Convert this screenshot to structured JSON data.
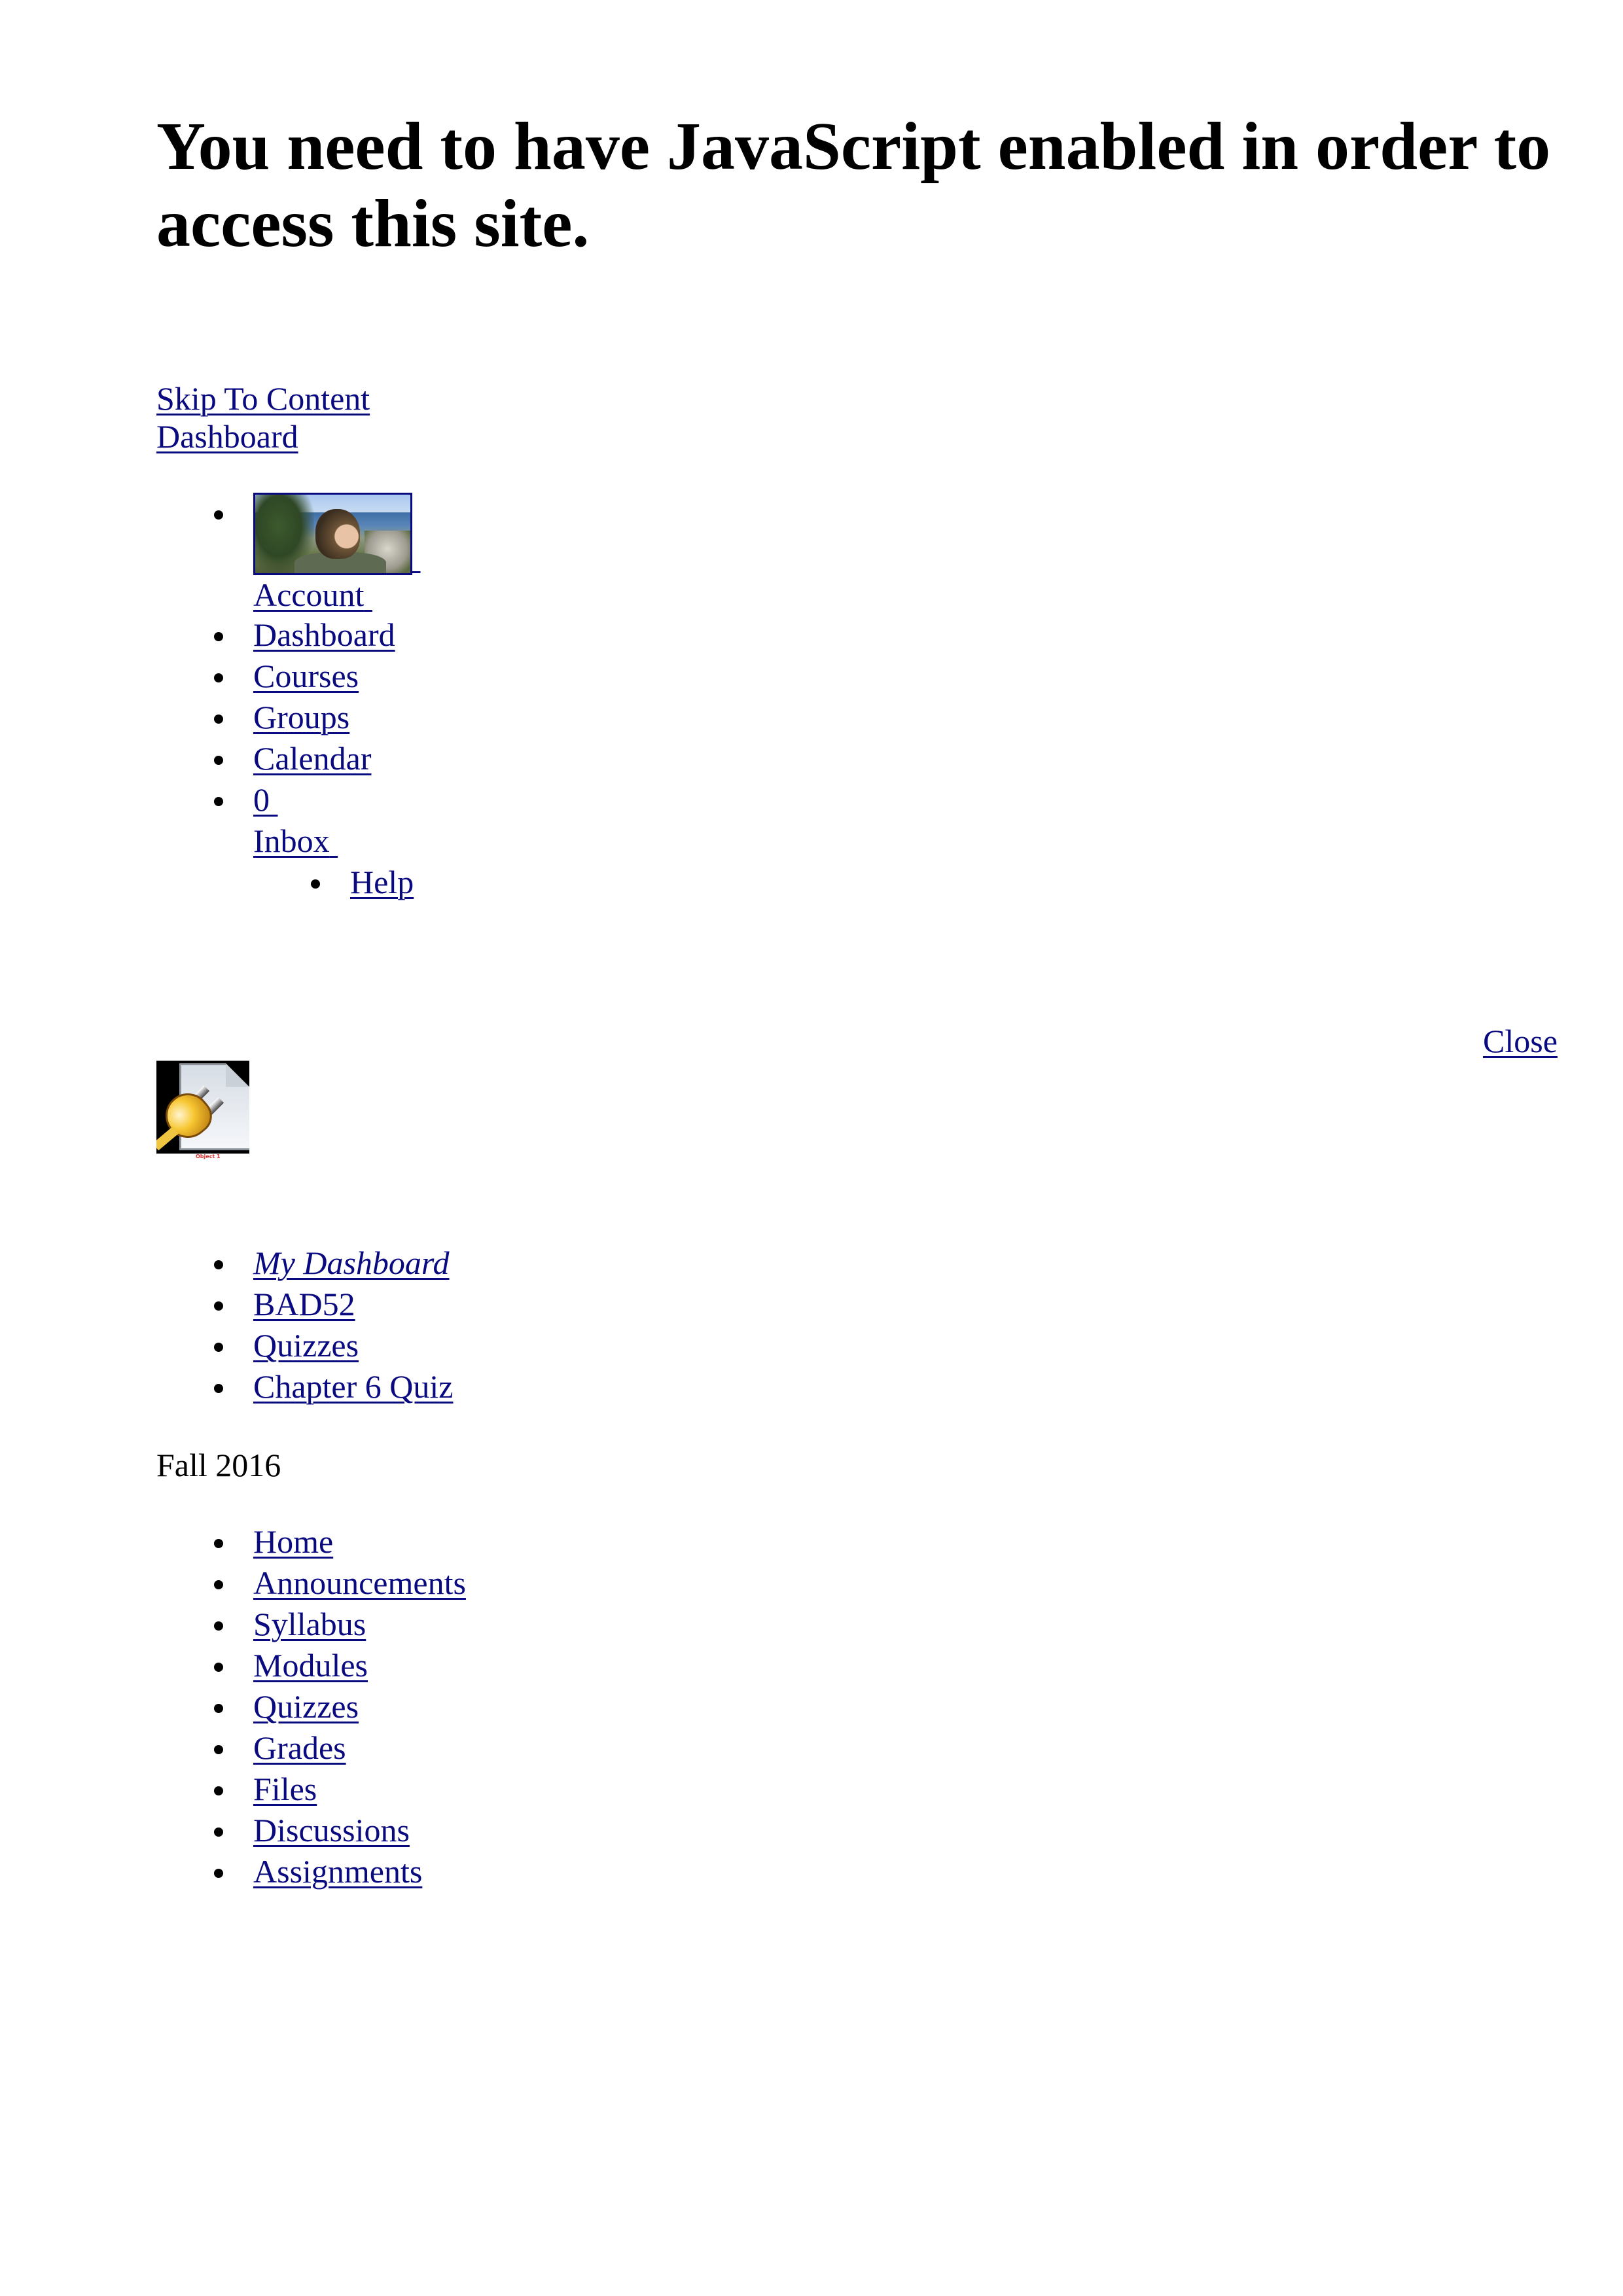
{
  "noscript_message": "You need to have JavaScript enabled in order to access this site.",
  "skip_link": "Skip To Content",
  "header_dashboard_link": "Dashboard",
  "global_nav": {
    "account_label": "Account",
    "items": [
      {
        "label": "Dashboard"
      },
      {
        "label": "Courses"
      },
      {
        "label": "Groups"
      },
      {
        "label": "Calendar"
      }
    ],
    "inbox_count": "0",
    "inbox_label": "Inbox",
    "help_label": "Help"
  },
  "plugin_notice": {
    "close_label": "Close",
    "plugin_icon": "missing-plugin-icon",
    "object_label": "Object 1"
  },
  "breadcrumbs": [
    {
      "label": "My Dashboard"
    },
    {
      "label": "BAD52"
    },
    {
      "label": "Quizzes"
    },
    {
      "label": "Chapter 6 Quiz"
    }
  ],
  "term": "Fall 2016",
  "course_nav": [
    {
      "label": "Home"
    },
    {
      "label": "Announcements"
    },
    {
      "label": "Syllabus"
    },
    {
      "label": "Modules"
    },
    {
      "label": "Quizzes"
    },
    {
      "label": "Grades"
    },
    {
      "label": "Files"
    },
    {
      "label": "Discussions"
    },
    {
      "label": "Assignments"
    }
  ],
  "colors": {
    "link": "#0a0a80",
    "text": "#000000",
    "object_label": "#e03030"
  }
}
